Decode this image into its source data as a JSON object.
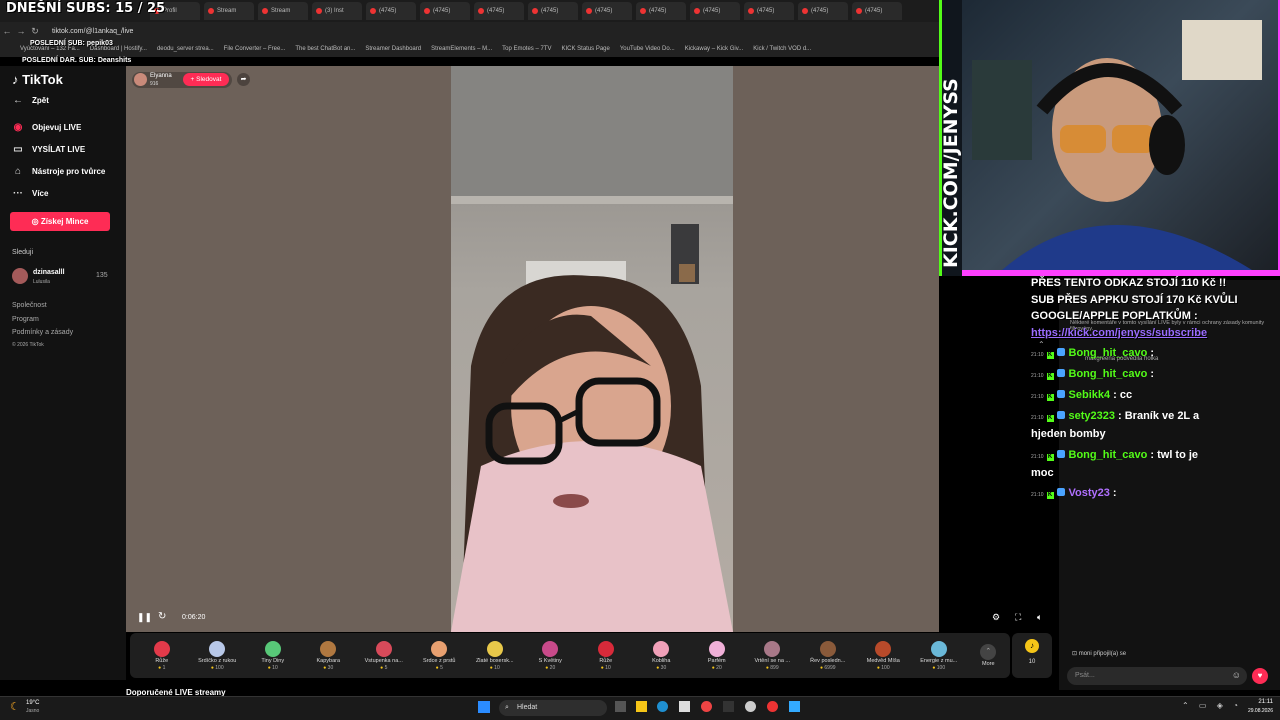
{
  "overlay": {
    "subs_title": "DNEŠNÍ SUBS: 15 / 25",
    "last_sub": "POSLEDNÍ SUB: pepik03",
    "last_gift_sub": "POSLEDNÍ DAR. SUB: Deanshits"
  },
  "browser": {
    "tabs": [
      "Profil",
      "Stream",
      "Stream",
      "(3) Inst",
      "(4745)",
      "(4745)",
      "(4745)",
      "(4745)",
      "(4745)",
      "(4745)",
      "(4745)",
      "(4745)",
      "(4745)",
      "(4745)"
    ],
    "url": "tiktok.com/@l1ankaq_/live",
    "bookmarks": [
      "Vyúčtování – 132 Fa...",
      "Dashboard | Hostify...",
      "deodu_server strea...",
      "File Converter – Free...",
      "The best ChatBot an...",
      "Streamer Dashboard",
      "StreamElements – M...",
      "Top Emotes – 7TV",
      "KICK Status Page",
      "YouTube Video Do...",
      "Kickaway – Kick Giv...",
      "Kick / Twitch VOD d..."
    ]
  },
  "sidebar": {
    "logo": "TikTok",
    "back": "Zpět",
    "nav": [
      "Objevuj LIVE",
      "VYSÍLAT LIVE",
      "Nástroje pro tvůrce",
      "Více"
    ],
    "coins_button": "Získej Mince",
    "following_heading": "Sleduji",
    "following_user": "dzinasalll",
    "following_sub": "Lulusila",
    "following_count": "135",
    "footer": [
      "Společnost",
      "Program",
      "Podmínky a zásady",
      "© 2026 TikTok"
    ]
  },
  "stream": {
    "host_name": "Elyanna",
    "host_likes": "916",
    "follow_button": "+ Sledovat",
    "time": "0:06:20",
    "recommended": "Doporučené LIVE streamy"
  },
  "gifts": [
    {
      "name": "Růže",
      "price": "1",
      "color": "#e23a4a"
    },
    {
      "name": "Srdíčko z rukou",
      "price": "100",
      "color": "#b8c8e8"
    },
    {
      "name": "Tiny Diny",
      "price": "10",
      "color": "#58c878"
    },
    {
      "name": "Kapybara",
      "price": "30",
      "color": "#b07840"
    },
    {
      "name": "Vstupenka na...",
      "price": "5",
      "color": "#d84a5a"
    },
    {
      "name": "Srdce z prstů",
      "price": "5",
      "color": "#e8a070"
    },
    {
      "name": "Zlaté boxersk...",
      "price": "10",
      "color": "#e8c84a"
    },
    {
      "name": "S Květiny",
      "price": "20",
      "color": "#c84a8a"
    },
    {
      "name": "Růže",
      "price": "10",
      "color": "#d82a3a"
    },
    {
      "name": "Kobliha",
      "price": "30",
      "color": "#f0a0b8"
    },
    {
      "name": "Parfém",
      "price": "20",
      "color": "#f0b0d8"
    },
    {
      "name": "Vrtění se na ...",
      "price": "899",
      "color": "#a87888"
    },
    {
      "name": "Řev posledn...",
      "price": "6999",
      "color": "#8a5a3a"
    },
    {
      "name": "Medvěd Míša",
      "price": "100",
      "color": "#b84a2a"
    },
    {
      "name": "Energie z mu...",
      "price": "100",
      "color": "#6ab8d8"
    }
  ],
  "gift_more": "More",
  "coin_count": "10",
  "kick": {
    "vertical_brand": "KICK.COM/JENYSS",
    "promo": [
      "PŘES TENTO ODKAZ STOJÍ 110 Kč !!",
      "SUB PŘES APPKU STOJÍ 170 Kč KVŮLI",
      "GOOGLE/APPLE POPLATKŮM :"
    ],
    "promo_link": "https://kick.com/jenyss/subscribe",
    "bg_notice": "Některé komentáře v tomto vysílání LIVE byly v rámci ochrany zásady komunity filtrovány.",
    "bg_comment": "maxgreena podvědila holka",
    "messages": [
      {
        "time": "21:10",
        "user": "Bong_hit_cavo",
        "text": ":",
        "color": "#53fc18"
      },
      {
        "time": "21:10",
        "user": "Bong_hit_cavo",
        "text": ":",
        "color": "#53fc18"
      },
      {
        "time": "21:10",
        "user": "Sebikk4",
        "text": ": cc",
        "color": "#53fc18"
      },
      {
        "time": "21:10",
        "user": "sety2323",
        "text": ": Braník ve 2L a",
        "color": "#53fc18"
      },
      {
        "time": "",
        "user": "",
        "text": "hjeden bomby",
        "color": "#ffffff"
      },
      {
        "time": "21:10",
        "user": "Bong_hit_cavo",
        "text": ": twl to je",
        "color": "#53fc18"
      },
      {
        "time": "",
        "user": "",
        "text": "moc",
        "color": "#ffffff"
      },
      {
        "time": "21:10",
        "user": "Vosty23",
        "text": ":",
        "color": "#b070ff"
      }
    ]
  },
  "right_panel": {
    "joined_user": "moni",
    "joined_text": "připojil(a) se",
    "input_placeholder": "Psát..."
  },
  "taskbar": {
    "temp": "19°C",
    "weather": "Jasno",
    "search": "Hledat",
    "time": "21:11",
    "date": "29.08.2026"
  }
}
